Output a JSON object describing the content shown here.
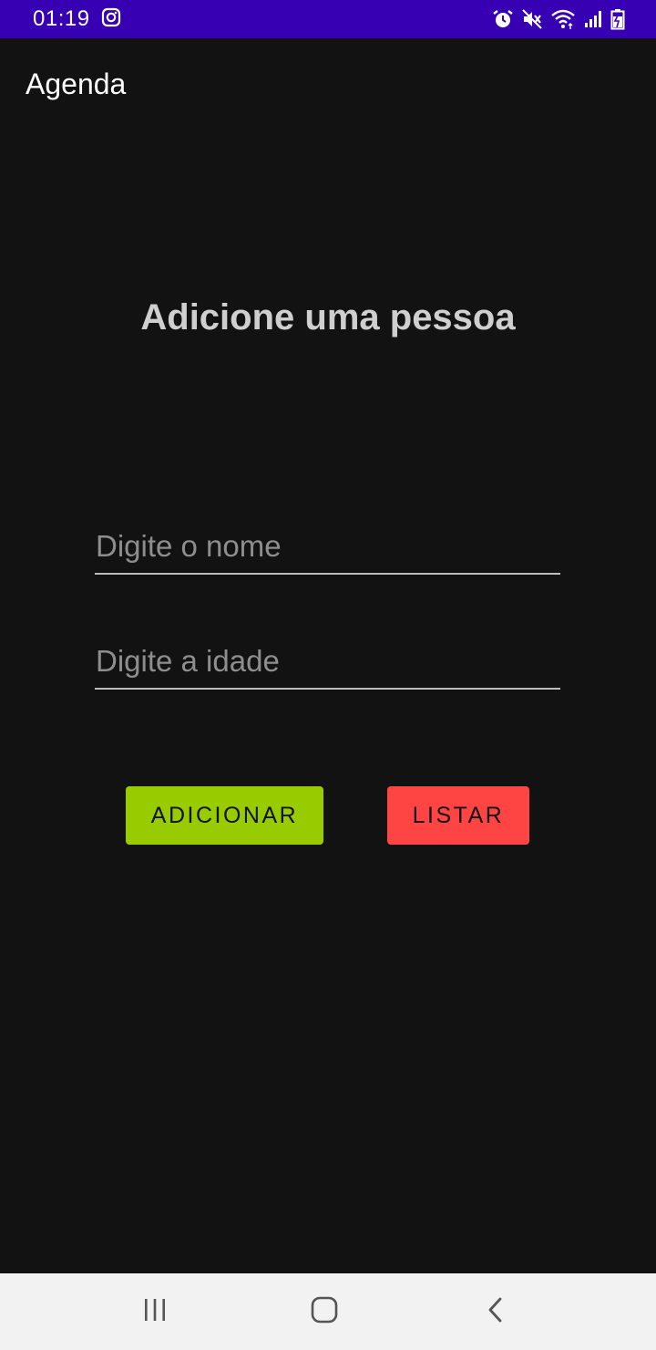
{
  "status_bar": {
    "time": "01:19",
    "icons": [
      "instagram-icon",
      "alarm-icon",
      "mute-icon",
      "wifi-icon",
      "signal-icon",
      "battery-icon"
    ],
    "color": "#3700B3"
  },
  "app_bar": {
    "title": "Agenda"
  },
  "form": {
    "heading": "Adicione uma pessoa",
    "name_placeholder": "Digite o nome",
    "age_placeholder": "Digite a idade",
    "name_value": "",
    "age_value": ""
  },
  "buttons": {
    "add_label": "ADICIONAR",
    "add_color": "#99CC00",
    "list_label": "LISTAR",
    "list_color": "#FF4444"
  },
  "nav_bar": {
    "icons": [
      "recent-apps-icon",
      "home-icon",
      "back-icon"
    ]
  }
}
